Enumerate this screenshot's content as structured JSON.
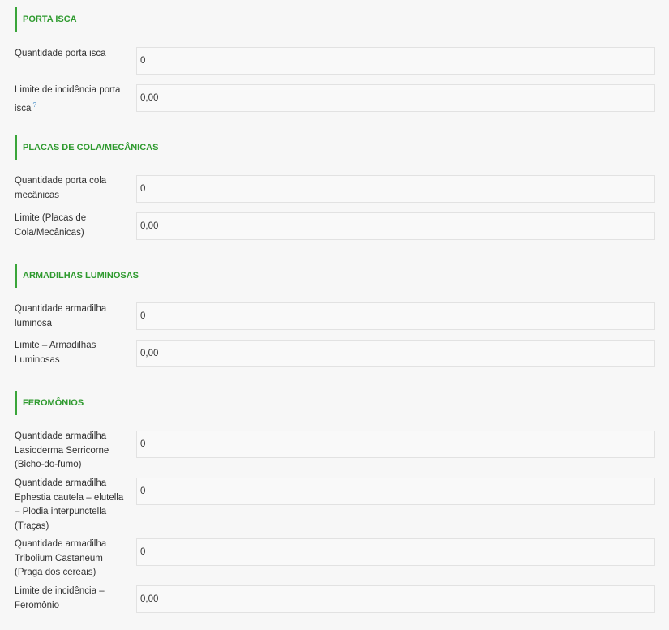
{
  "sections": [
    {
      "title": "PORTA ISCA",
      "rows": [
        {
          "label": "Quantidade porta isca",
          "value": "0"
        },
        {
          "label": "Limite de incidência porta isca",
          "help": "?",
          "value": "0,00"
        }
      ]
    },
    {
      "title": "PLACAS DE COLA/MECÂNICAS",
      "rows": [
        {
          "label": "Quantidade porta cola mecânicas",
          "value": "0"
        },
        {
          "label": "Limite (Placas de Cola/Mecânicas)",
          "value": "0,00"
        }
      ]
    },
    {
      "title": "ARMADILHAS LUMINOSAS",
      "rows": [
        {
          "label": "Quantidade armadilha luminosa",
          "value": "0"
        },
        {
          "label": "Limite – Armadilhas Luminosas",
          "value": "0,00"
        }
      ]
    },
    {
      "title": "FEROMÔNIOS",
      "rows": [
        {
          "label": "Quantidade armadilha Lasioderma Serricorne (Bicho-do-fumo)",
          "value": "0"
        },
        {
          "label": "Quantidade armadilha Ephestia cautela – elutella – Plodia interpunctella (Traças)",
          "value": "0"
        },
        {
          "label": "Quantidade armadilha Tribolium Castaneum (Praga dos cereais)",
          "value": "0"
        },
        {
          "label": "Limite de incidência – Feromônio",
          "value": "0,00"
        }
      ]
    }
  ],
  "colors": {
    "accent": "#3aa53a",
    "section_title": "#2e9a2e",
    "help": "#4a90c8",
    "background": "#f7f7f7"
  }
}
